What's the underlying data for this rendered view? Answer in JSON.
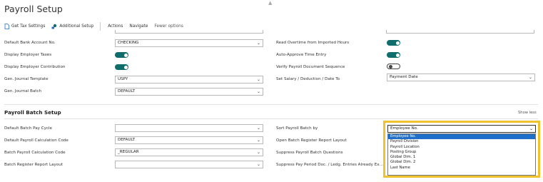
{
  "page": {
    "title": "Payroll Setup"
  },
  "actions": [
    {
      "label": "Get Tax Settings",
      "icon": "document-icon"
    },
    {
      "label": "Additional Setup",
      "icon": "settings-icon"
    },
    {
      "label": "Actions"
    },
    {
      "label": "Navigate"
    },
    {
      "label": "Fewer options"
    }
  ],
  "general": {
    "left": {
      "default_bank_account": {
        "label": "Default Bank Account No.",
        "value": "CHECKING"
      },
      "display_employer_taxes": {
        "label": "Display Employer Taxes",
        "on": true
      },
      "display_employer_contribution": {
        "label": "Display Employer Contribution",
        "on": true
      },
      "gen_journal_template": {
        "label": "Gen. Journal Template",
        "value": "USPY"
      },
      "gen_journal_batch": {
        "label": "Gen. Journal Batch",
        "value": "DEFAULT"
      }
    },
    "right": {
      "read_overtime": {
        "label": "Read Overtime from Imported Hours",
        "on": true
      },
      "auto_approve": {
        "label": "Auto-Approve Time Entry",
        "on": true
      },
      "verify_sequence": {
        "label": "Verify Payroll Document Sequence",
        "on": false
      },
      "set_salary_date": {
        "label": "Set Salary / Deduction / Date To",
        "value": "Payment Date"
      }
    }
  },
  "batch_section": {
    "title": "Payroll Batch Setup",
    "show_less": "Show less",
    "left": {
      "default_batch_pay_cycle": {
        "label": "Default Batch Pay Cycle",
        "value": ""
      },
      "default_payroll_calc_code": {
        "label": "Default Payroll Calculation Code",
        "value": "DEFAULT"
      },
      "batch_payroll_calc_code": {
        "label": "Batch Payroll Calculation Code",
        "value": "_REGULAR"
      },
      "batch_register_report_layout": {
        "label": "Batch Register Report Layout",
        "value": ""
      }
    },
    "right": {
      "sort_payroll_batch_by": {
        "label": "Sort Payroll Batch by",
        "value": "Employee No."
      },
      "open_batch_register_layout": {
        "label": "Open Batch Register Report Layout"
      },
      "suppress_batch_questions": {
        "label": "Suppress Payroll Batch Questions"
      },
      "suppress_pay_period": {
        "label": "Suppress Pay Period Doc. / Ledg. Entries Already Ex..."
      }
    }
  },
  "sort_dropdown": {
    "options": [
      "Employee No.",
      "Payroll Division",
      "Payroll Location",
      "Posting Group",
      "Global Dim. 1",
      "Global Dim. 2",
      "Last Name"
    ],
    "highlighted_index": 0
  },
  "colors": {
    "toggle_on": "#0f6e6c",
    "highlight_border": "#f2c12e",
    "selected_option": "#1e6fc9"
  }
}
